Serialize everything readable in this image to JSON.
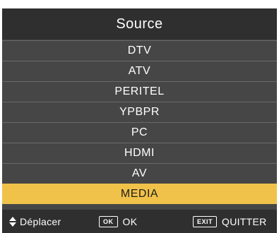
{
  "menu": {
    "title": "Source",
    "items": [
      {
        "label": "DTV"
      },
      {
        "label": "ATV"
      },
      {
        "label": "PERITEL"
      },
      {
        "label": "YPBPR"
      },
      {
        "label": "PC"
      },
      {
        "label": "HDMI"
      },
      {
        "label": "AV"
      },
      {
        "label": "MEDIA"
      }
    ],
    "selected_index": 7
  },
  "footer": {
    "move_icon": "up-down-arrows-icon",
    "move_label": "Déplacer",
    "ok_key": "OK",
    "ok_label": "OK",
    "exit_key": "EXIT",
    "exit_label": "QUITTER"
  },
  "colors": {
    "panel": "#464646",
    "header": "#2f2f2f",
    "highlight": "#f1c24a"
  }
}
